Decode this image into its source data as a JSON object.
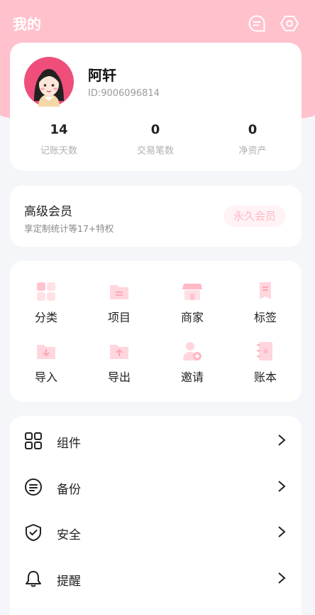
{
  "header": {
    "title": "我的"
  },
  "profile": {
    "name": "阿轩",
    "id": "ID:9006096814",
    "stats": [
      {
        "value": "14",
        "label": "记账天数"
      },
      {
        "value": "0",
        "label": "交易笔数"
      },
      {
        "value": "0",
        "label": "净资产"
      }
    ]
  },
  "membership": {
    "title": "高级会员",
    "subtitle": "享定制统计等17+特权",
    "badge": "永久会员"
  },
  "features": [
    {
      "label": "分类",
      "icon": "category-icon"
    },
    {
      "label": "项目",
      "icon": "project-folder-icon"
    },
    {
      "label": "商家",
      "icon": "store-icon"
    },
    {
      "label": "标签",
      "icon": "tag-icon"
    },
    {
      "label": "导入",
      "icon": "import-icon"
    },
    {
      "label": "导出",
      "icon": "export-icon"
    },
    {
      "label": "邀请",
      "icon": "invite-icon"
    },
    {
      "label": "账本",
      "icon": "ledger-icon"
    }
  ],
  "menu": [
    {
      "label": "组件",
      "icon": "widgets-icon"
    },
    {
      "label": "备份",
      "icon": "backup-icon"
    },
    {
      "label": "安全",
      "icon": "shield-icon"
    },
    {
      "label": "提醒",
      "icon": "bell-icon"
    }
  ],
  "colors": {
    "accent": "#ffc1cc",
    "icon_pink": "#ffd3da",
    "badge_text": "#ffb8c4"
  }
}
